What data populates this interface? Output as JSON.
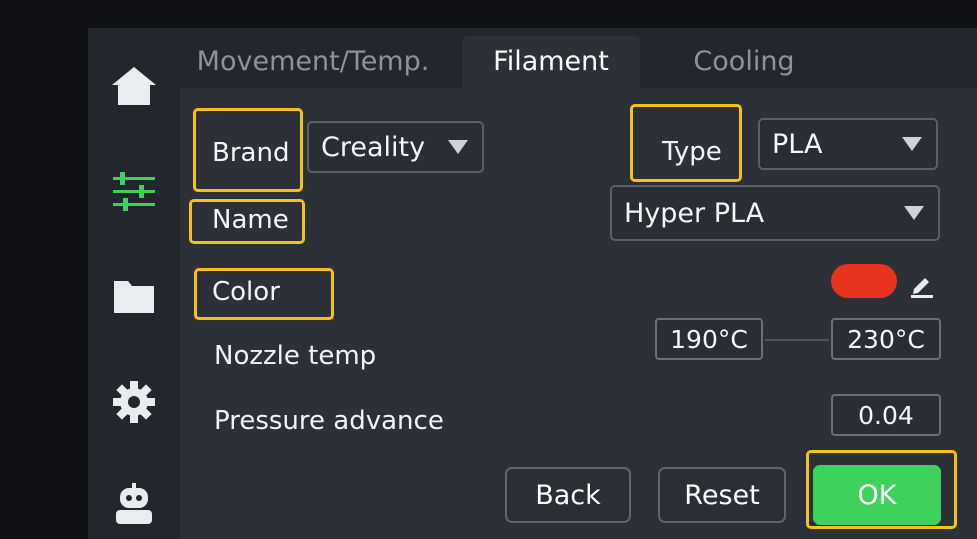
{
  "tabs": [
    {
      "label": "Movement/Temp.",
      "active": false
    },
    {
      "label": "Filament",
      "active": true
    },
    {
      "label": "Cooling",
      "active": false
    }
  ],
  "sidebar": {
    "items": [
      {
        "icon": "home-icon"
      },
      {
        "icon": "sliders-icon",
        "active": true
      },
      {
        "icon": "folder-icon"
      },
      {
        "icon": "gear-icon"
      },
      {
        "icon": "robot-icon"
      }
    ]
  },
  "form": {
    "brand_label": "Brand",
    "brand_value": "Creality",
    "type_label": "Type",
    "type_value": "PLA",
    "name_label": "Name",
    "name_value": "Hyper PLA",
    "color_label": "Color",
    "color_value": "#e8331f",
    "nozzle_label": "Nozzle temp",
    "nozzle_min": "190°C",
    "nozzle_max": "230°C",
    "pressure_label": "Pressure advance",
    "pressure_value": "0.04"
  },
  "buttons": {
    "back": "Back",
    "reset": "Reset",
    "ok": "OK"
  },
  "colors": {
    "accent_green": "#3ed15c",
    "highlight": "#f5c21a",
    "filament_color": "#e8331f"
  }
}
